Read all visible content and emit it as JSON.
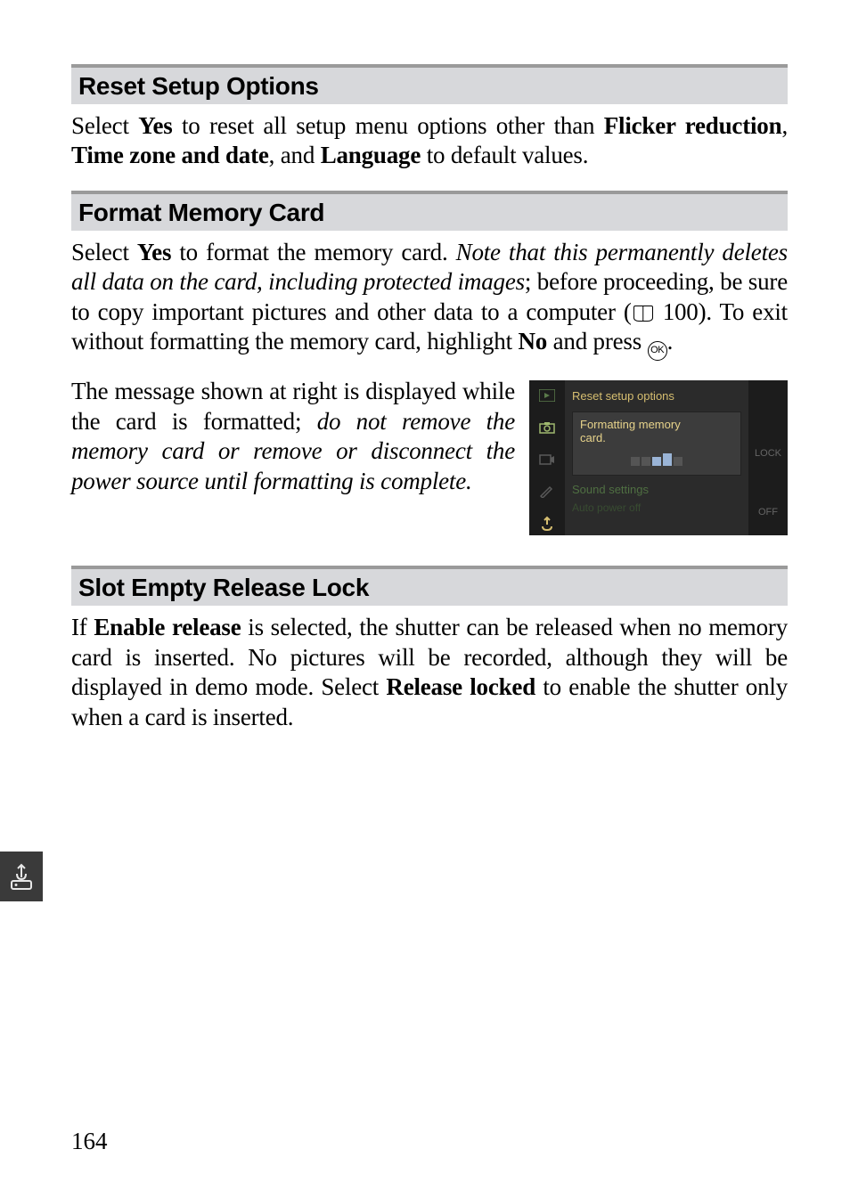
{
  "sections": {
    "reset": {
      "title": "Reset Setup Options",
      "body_html": "Select <b>Yes</b> to reset all setup menu options other than <b>Flicker reduction</b>, <b>Time zone and date</b>, and <b>Language</b> to default values."
    },
    "format": {
      "title": "Format Memory Card",
      "body1_html": "Select <b>Yes</b> to format the memory card. <i>Note that this permanently deletes all data on the card, including protected images</i>; before proceeding, be sure to copy important pictures and other data to a computer (<span class=\"book-icon\" data-name=\"book-icon\" data-interactable=\"false\"></span> 100). To exit without formatting the memory card, highlight <b>No</b> and press <span class=\"ok-icon\" data-name=\"ok-button-icon\" data-interactable=\"false\">OK</span>.",
      "body2_html": "The message shown at right is displayed while the card is formatted; <i>do not remove the memory card or remove or disconnect the power source until formatting is complete.</i>"
    },
    "slot": {
      "title": "Slot Empty Release Lock",
      "body_html": "If <b>Enable release</b> is selected, the shutter can be released when no memory card is inserted. No pictures will be recorded, although they will be displayed in demo mode. Select <b>Release locked</b> to enable the shutter only when a card is inserted."
    }
  },
  "screenshot": {
    "menu_title": "Reset setup options",
    "formatting_line1": "Formatting memory",
    "formatting_line2": "card.",
    "right_badges": [
      "",
      "",
      "LOCK",
      "",
      "OFF"
    ],
    "items": [
      "Sound settings",
      "Auto power off"
    ]
  },
  "page_number": "164"
}
